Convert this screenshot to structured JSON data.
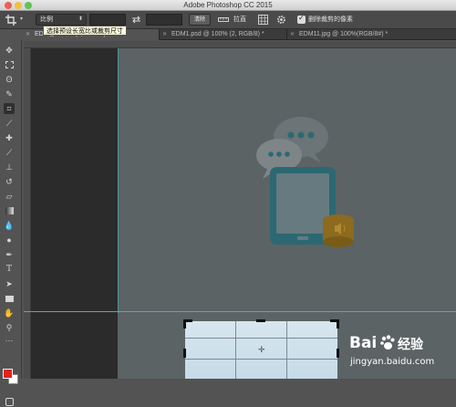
{
  "window": {
    "title": "Adobe Photoshop CC 2015"
  },
  "options_bar": {
    "ratio_select": "比例",
    "clear_button": "清除",
    "straighten_label": "拉直",
    "delete_cropped_label": "删除裁剪的像素",
    "delete_cropped_checked": true
  },
  "tooltip": {
    "text": "选择预设长宽比或裁剪尺寸"
  },
  "tabs": [
    {
      "label": "EDM@ 100% (8, RGB/8) *",
      "active": true
    },
    {
      "label": "EDM1.psd @ 100% (2, RGB/8) *",
      "active": false
    },
    {
      "label": "EDM11.jpg @ 100%(RGB/8#) *",
      "active": false
    }
  ],
  "watermark": {
    "brand": "Bai",
    "brand_suffix": "经验",
    "url": "jingyan.baidu.com"
  },
  "colors": {
    "foreground": "#e0231d",
    "background": "#ffffff",
    "guide": "#3fb2b5",
    "artwork_teal": "#2c6873",
    "artwork_gold": "#8c6a1e"
  }
}
